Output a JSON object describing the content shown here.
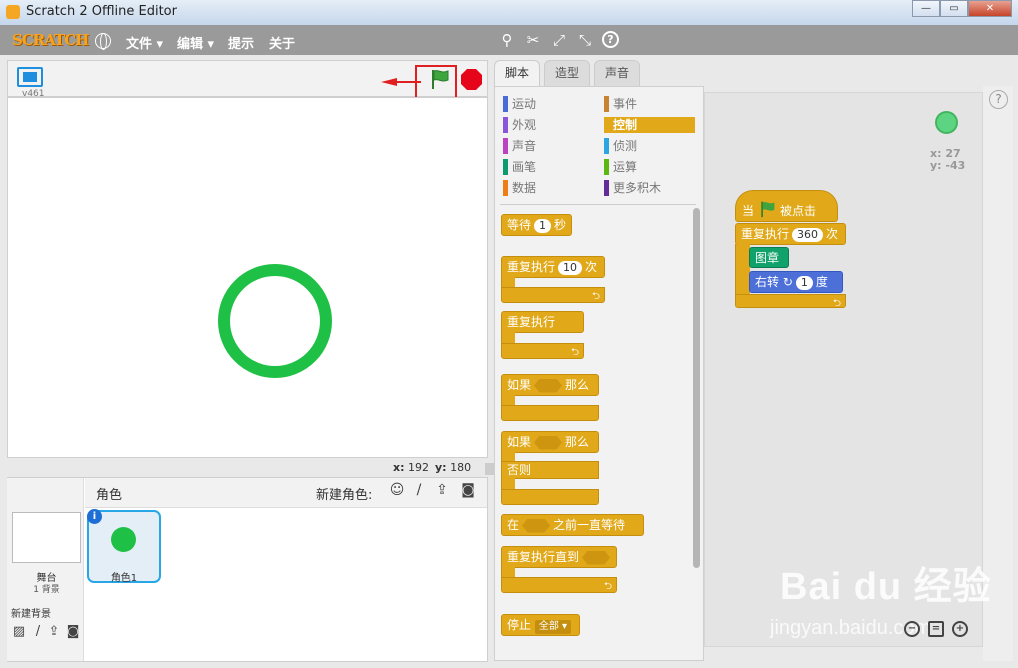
{
  "window": {
    "title": "Scratch 2 Offline Editor",
    "min": "—",
    "max": "▭",
    "close": "✕"
  },
  "menubar": {
    "logo": "SCRATCH",
    "items": [
      "文件 ▾",
      "编辑 ▾",
      "提示",
      "关于"
    ],
    "tools": [
      "duplicate-stamp-icon",
      "cut-scissors-icon",
      "grow-icon",
      "shrink-icon",
      "help-icon"
    ]
  },
  "stage": {
    "version": "v461",
    "mouse_x_label": "x:",
    "mouse_x": "192",
    "mouse_y_label": "y:",
    "mouse_y": "180"
  },
  "sprites": {
    "label": "角色",
    "new_sprite_label": "新建角色:",
    "stage_name": "舞台",
    "backdrop_count": "1 背景",
    "new_backdrop": "新建背景",
    "items": [
      {
        "name": "角色1",
        "color": "#1fc046"
      }
    ]
  },
  "tabs": [
    "脚本",
    "造型",
    "声音"
  ],
  "categories": {
    "left": [
      {
        "label": "运动",
        "color": "#4a6cd4"
      },
      {
        "label": "外观",
        "color": "#8a55d7"
      },
      {
        "label": "声音",
        "color": "#bb42c3"
      },
      {
        "label": "画笔",
        "color": "#0e9a6c"
      },
      {
        "label": "数据",
        "color": "#ee7d16"
      }
    ],
    "right": [
      {
        "label": "事件",
        "color": "#c88330"
      },
      {
        "label": "控制",
        "color": "#e1a91a"
      },
      {
        "label": "侦测",
        "color": "#2ca5e2"
      },
      {
        "label": "运算",
        "color": "#5cb712"
      },
      {
        "label": "更多积木",
        "color": "#632d99"
      }
    ]
  },
  "palette": {
    "wait": {
      "pre": "等待",
      "value": "1",
      "post": "秒"
    },
    "repeat": {
      "pre": "重复执行",
      "value": "10",
      "post": "次"
    },
    "forever": "重复执行",
    "if_then": {
      "pre": "如果",
      "post": "那么"
    },
    "if_else": {
      "pre": "如果",
      "post": "那么",
      "else": "否则"
    },
    "wait_until": {
      "pre": "在",
      "post": "之前一直等待"
    },
    "repeat_until": "重复执行直到",
    "stop": {
      "pre": "停止",
      "option": "全部 ▾"
    }
  },
  "script": {
    "hat": {
      "pre": "当",
      "post": "被点击"
    },
    "repeat": {
      "pre": "重复执行",
      "value": "360",
      "post": "次"
    },
    "stamp": "图章",
    "turn": {
      "pre": "右转",
      "value": "1",
      "post": "度"
    },
    "sprite_x_label": "x:",
    "sprite_x": "27",
    "sprite_y_label": "y:",
    "sprite_y": "-43"
  },
  "watermark": {
    "main": "Bai du 经验",
    "sub": "jingyan.baidu.com"
  },
  "colors": {
    "control": "#e1a91a",
    "pen": "#11a26c",
    "motion": "#4c6fd8",
    "sprite": "#1fc046",
    "highlight": "#e02020"
  }
}
